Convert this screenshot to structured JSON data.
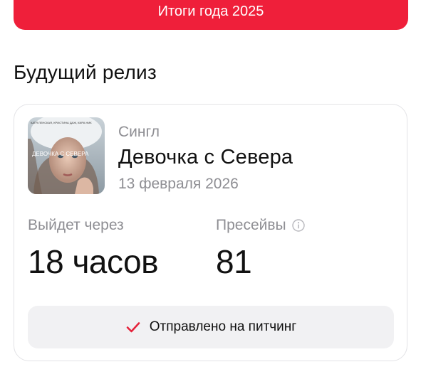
{
  "banner": {
    "label": "Итоги года 2025",
    "color": "#ef1f3a"
  },
  "section": {
    "title": "Будущий релиз"
  },
  "release": {
    "type": "Сингл",
    "title": "Девочка с Севера",
    "date": "13 февраля 2026",
    "cover_text": "ДЕВОЧКА С СЕВЕРА",
    "cover_small_text": "КАТЯ ЛЕНСКАЯ, КРИСТИНА ДАЖ, КИРА НИК"
  },
  "stats": {
    "release_in": {
      "label": "Выйдет через",
      "value": "18 часов"
    },
    "presaves": {
      "label": "Пресейвы",
      "value": "81",
      "icon": "info-icon"
    }
  },
  "pitch": {
    "label": "Отправлено на питчинг",
    "icon": "check-icon",
    "icon_color": "#e5233b"
  }
}
